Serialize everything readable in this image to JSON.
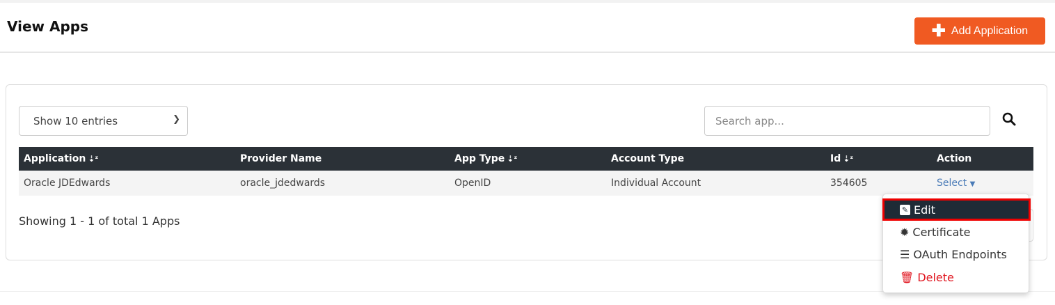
{
  "header": {
    "title": "View Apps",
    "add_button": "Add Application"
  },
  "controls": {
    "entries_select": "Show 10 entries",
    "search_placeholder": "Search app..."
  },
  "table": {
    "columns": [
      "Application",
      "Provider Name",
      "App Type",
      "Account Type",
      "Id",
      "Action"
    ],
    "rows": [
      {
        "application": "Oracle JDEdwards",
        "provider": "oracle_jdedwards",
        "app_type": "OpenID",
        "account_type": "Individual Account",
        "id": "354605",
        "action": "Select"
      }
    ]
  },
  "footer": {
    "showing": "Showing 1 - 1 of total 1 Apps"
  },
  "menu": {
    "items": [
      "Edit",
      "Certificate",
      "OAuth Endpoints",
      "Delete"
    ]
  },
  "colors": {
    "accent": "#f05a22",
    "header_bg": "#2b3137",
    "delete": "#e0141e",
    "highlight": "#ee0000"
  }
}
